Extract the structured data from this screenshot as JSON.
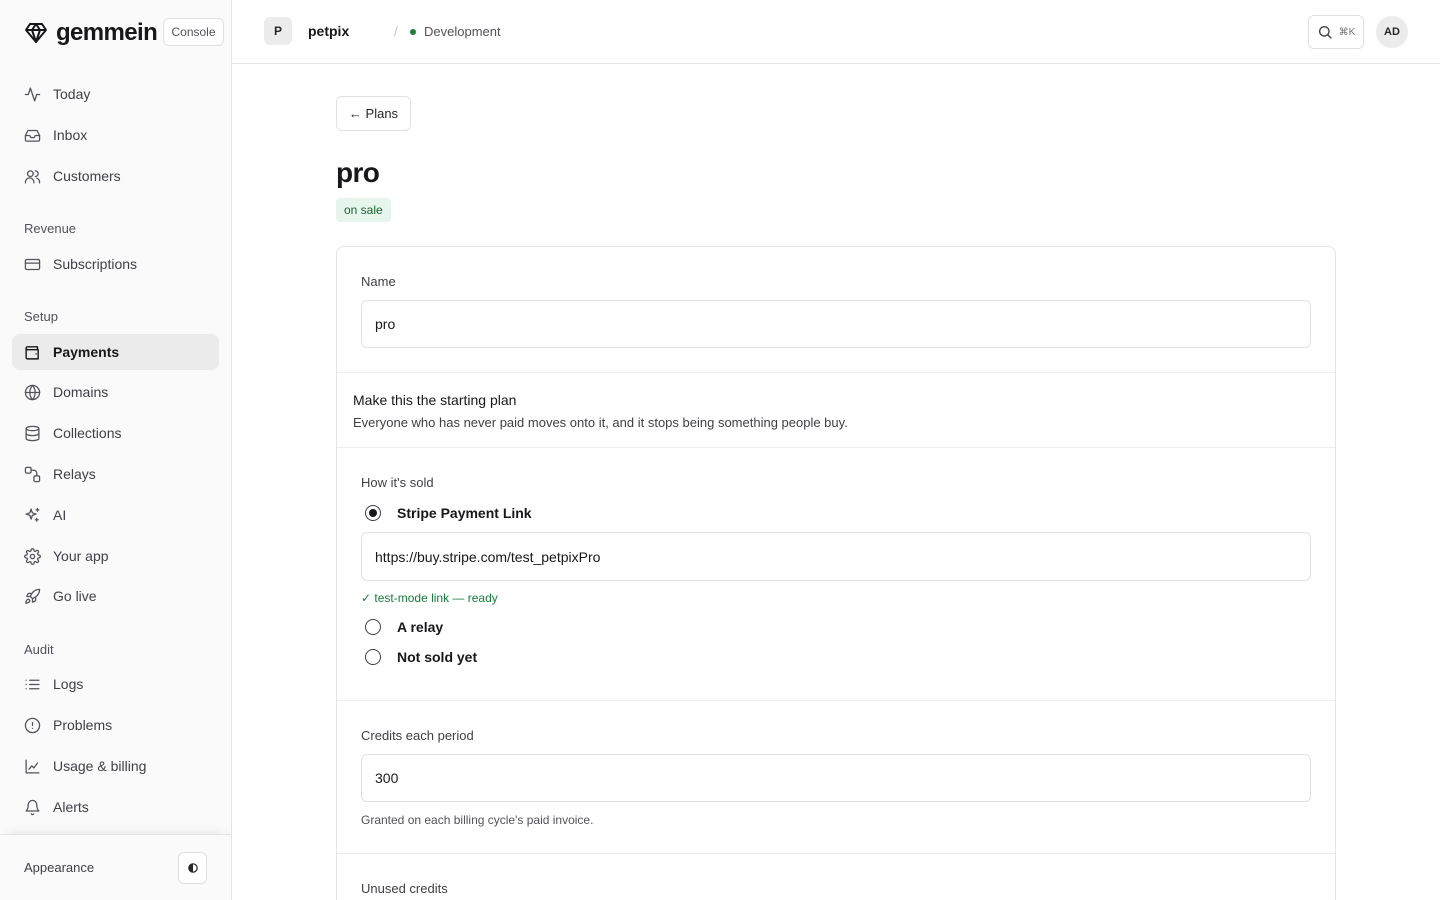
{
  "brand": {
    "name": "gemmein",
    "console_label": "Console"
  },
  "nav": {
    "primary": [
      {
        "label": "Today",
        "icon": "activity-icon"
      },
      {
        "label": "Inbox",
        "icon": "inbox-icon"
      },
      {
        "label": "Customers",
        "icon": "users-icon"
      }
    ],
    "revenue_label": "Revenue",
    "revenue": [
      {
        "label": "Subscriptions",
        "icon": "credit-card-icon"
      }
    ],
    "setup_label": "Setup",
    "setup": [
      {
        "label": "Payments",
        "icon": "wallet-icon",
        "active": true
      },
      {
        "label": "Domains",
        "icon": "globe-icon"
      },
      {
        "label": "Collections",
        "icon": "database-icon"
      },
      {
        "label": "Relays",
        "icon": "relay-icon"
      },
      {
        "label": "AI",
        "icon": "sparkles-icon"
      },
      {
        "label": "Your app",
        "icon": "gear-icon"
      },
      {
        "label": "Go live",
        "icon": "rocket-icon"
      }
    ],
    "audit_label": "Audit",
    "audit": [
      {
        "label": "Logs",
        "icon": "list-icon"
      },
      {
        "label": "Problems",
        "icon": "alert-circle-icon"
      },
      {
        "label": "Usage & billing",
        "icon": "chart-icon"
      },
      {
        "label": "Alerts",
        "icon": "bell-icon"
      }
    ],
    "appearance_label": "Appearance"
  },
  "topbar": {
    "project_initial": "P",
    "project_name": "petpix",
    "separator": "/",
    "environment": "Development",
    "search_shortcut": "⌘K",
    "user_initials": "AD"
  },
  "page": {
    "back_label": "← Plans",
    "title": "pro",
    "status_badge": "on sale"
  },
  "form": {
    "name_label": "Name",
    "name_value": "pro",
    "starting_plan_title": "Make this the starting plan",
    "starting_plan_desc": "Everyone who has never paid moves onto it, and it stops being something people buy.",
    "sold_label": "How it's sold",
    "sold_options": [
      {
        "label": "Stripe Payment Link",
        "selected": true
      },
      {
        "label": "A relay",
        "selected": false
      },
      {
        "label": "Not sold yet",
        "selected": false
      }
    ],
    "payment_link_value": "https://buy.stripe.com/test_petpixPro",
    "payment_link_status": "✓ test-mode link — ready",
    "credits_label": "Credits each period",
    "credits_value": "300",
    "credits_hint": "Granted on each billing cycle's paid invoice.",
    "unused_credits_label": "Unused credits"
  },
  "colors": {
    "accent_green": "#15803d",
    "badge_bg": "#e7f6ec",
    "active_nav_bg": "#ebebeb"
  }
}
